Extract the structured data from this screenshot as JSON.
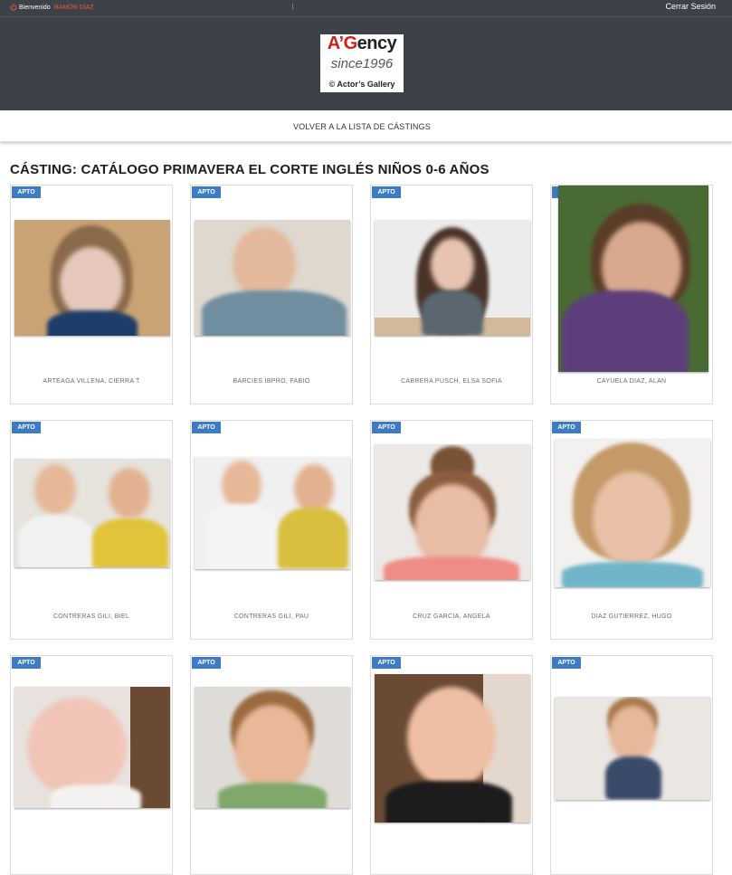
{
  "header": {
    "welcome_label": "Bienvenido",
    "user_name": "RAMÓN DÍAZ",
    "logout_label": "Cerrar Sesión",
    "logo": {
      "line1_a": "A’G",
      "line1_b": "ency",
      "line2": "since1996",
      "line3": "© Actor’s Gallery"
    }
  },
  "nav": {
    "back_label": "VOLVER A LA LISTA DE CÁSTINGS"
  },
  "page": {
    "title": "CÁSTING: CATÁLOGO PRIMAVERA EL CORTE INGLÉS NIÑOS 0-6 AÑOS"
  },
  "cards": [
    {
      "badge": "APTO",
      "name": "ARTEAGA VILLENA, CIERRA T"
    },
    {
      "badge": "APTO",
      "name": "BARCIES IBPRO, FABIO"
    },
    {
      "badge": "APTO",
      "name": "CABRERA PUSCH, ELSA SOFIA"
    },
    {
      "badge": "APTO",
      "name": "CAYUELA DIAZ, ALAN"
    },
    {
      "badge": "APTO",
      "name": "CONTRERAS GILI, BIEL"
    },
    {
      "badge": "APTO",
      "name": "CONTRERAS GILI, PAU"
    },
    {
      "badge": "APTO",
      "name": "CRUZ GARCIA, ANGELA"
    },
    {
      "badge": "APTO",
      "name": "DIAZ GUTIERREZ, HUGO"
    },
    {
      "badge": "APTO",
      "name": ""
    },
    {
      "badge": "APTO",
      "name": ""
    },
    {
      "badge": "APTO",
      "name": ""
    },
    {
      "badge": "APTO",
      "name": ""
    }
  ],
  "colors": {
    "header_bg": "#3d4148",
    "badge": "#3d7bc5",
    "user_accent": "#e8593b"
  }
}
